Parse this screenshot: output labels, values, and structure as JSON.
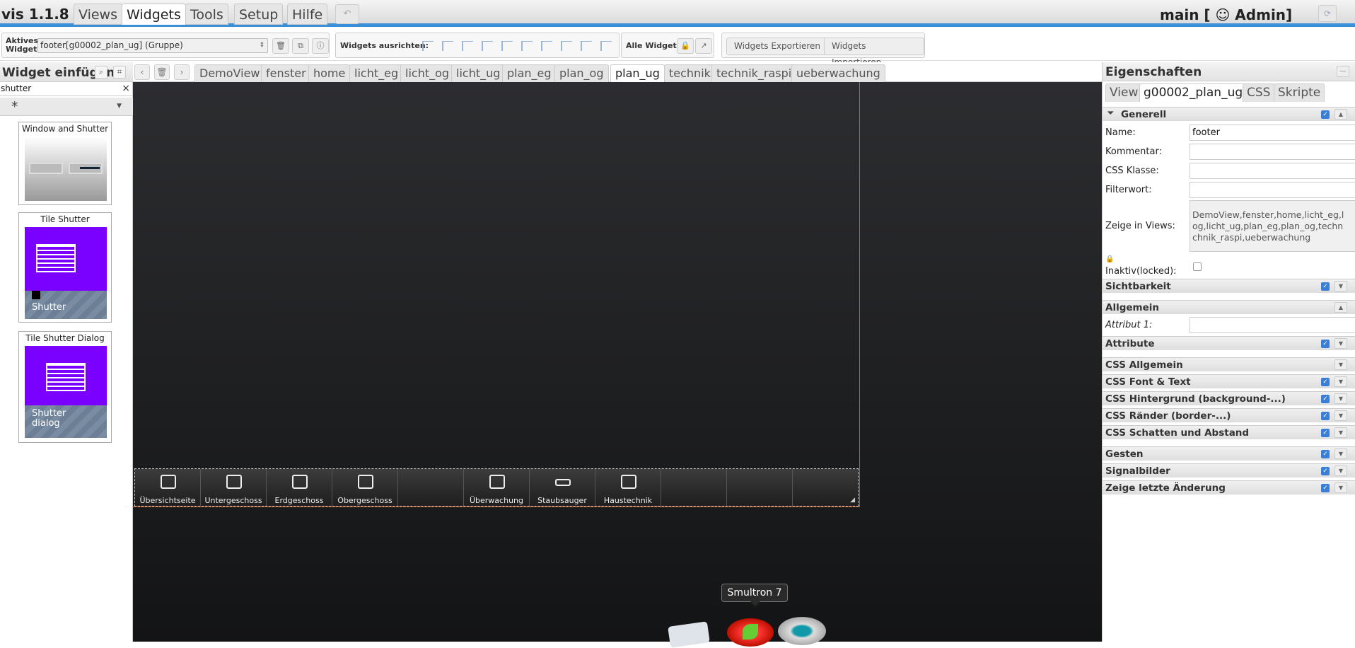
{
  "app": {
    "title": "vis 1.1.8",
    "menu": [
      "Views",
      "Widgets",
      "Tools",
      "Setup",
      "Hilfe"
    ],
    "undo_icon": "undo-icon",
    "user": "main [ ☺ Admin]",
    "refresh_icon": "refresh-icon"
  },
  "toolbar": {
    "active_widget_label": "Aktives Widget:",
    "active_widget_value": "footer[g00002_plan_ug] (Gruppe)",
    "align_label": "Widgets ausrichten:",
    "all_widgets_label": "Alle Widgets:",
    "export_label": "Widgets Exportieren",
    "import_label": "Widgets Importieren"
  },
  "left_panel": {
    "title": "Widget einfügen",
    "search_value": "shutter",
    "clear": "×",
    "filter": "*",
    "widgets": [
      {
        "title": "Window and Shutter"
      },
      {
        "title": "Tile Shutter",
        "caption": "Shutter"
      },
      {
        "title": "Tile Shutter Dialog",
        "caption": "Shutter dialog"
      }
    ]
  },
  "view_tabs": [
    "DemoView",
    "fenster",
    "home",
    "licht_eg",
    "licht_og",
    "licht_ug",
    "plan_eg",
    "plan_og",
    "plan_ug",
    "technik",
    "technik_raspi",
    "ueberwachung"
  ],
  "active_view": "plan_ug",
  "footer_widget": {
    "buttons": [
      "Übersichtseite",
      "Untergeschoss",
      "Erdgeschoss",
      "Obergeschoss",
      "",
      "Überwachung",
      "Staubsauger",
      "Haustechnik",
      "",
      "",
      ""
    ]
  },
  "dock": {
    "tooltip": "Smultron 7"
  },
  "properties": {
    "title": "Eigenschaften",
    "tabs": [
      "View",
      "g00002_plan_ug",
      "CSS",
      "Skripte"
    ],
    "general_section": "Generell",
    "name_label": "Name:",
    "name_value": "footer",
    "comment_label": "Kommentar:",
    "css_class_label": "CSS Klasse:",
    "filter_label": "Filterwort:",
    "views_label": "Zeige in Views:",
    "views_value": "DemoView,fenster,home,licht_eg,l\nog,licht_ug,plan_eg,plan_og,techn\nchnik_raspi,ueberwachung",
    "locked_label": "Inaktiv(locked):",
    "visibility_section": "Sichtbarkeit",
    "common_section": "Allgemein",
    "attr1_label": "Attribut 1:",
    "attributes_section": "Attribute",
    "css_sections": [
      "CSS Allgemein",
      "CSS Font & Text",
      "CSS Hintergrund (background-...)",
      "CSS Ränder (border-...)",
      "CSS Schatten und Abstand"
    ],
    "bottom_sections": [
      "Gesten",
      "Signalbilder",
      "Zeige letzte Änderung"
    ]
  },
  "colors": {
    "accent": "#3a8fd9",
    "tile_purple": "#7a00ff",
    "selection_border": "#d05a20"
  }
}
